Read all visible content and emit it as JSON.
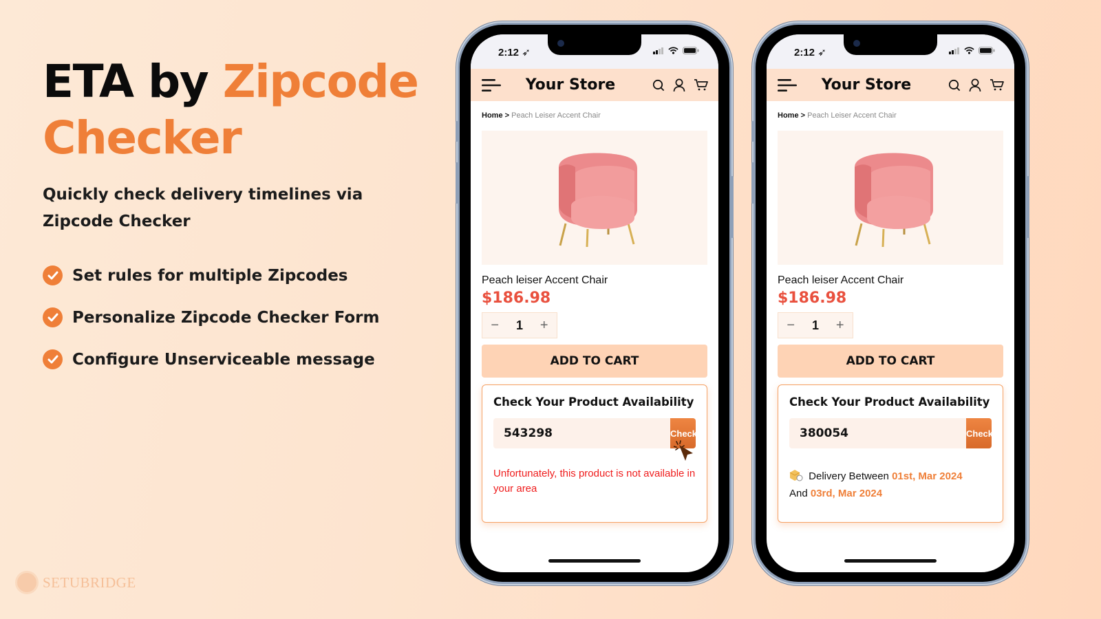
{
  "hero": {
    "title_part1": "ETA by ",
    "title_part2": "Zipcode",
    "title_part3": "Checker",
    "subtitle": "Quickly check delivery timelines via Zipcode Checker"
  },
  "features": [
    {
      "label": "Set rules for multiple Zipcodes",
      "icon": "check-circle-icon"
    },
    {
      "label": "Personalize Zipcode Checker Form",
      "icon": "check-circle-icon"
    },
    {
      "label": "Configure Unserviceable message",
      "icon": "check-circle-icon"
    }
  ],
  "brand": {
    "name": "SETUBRIDGE"
  },
  "colors": {
    "accent": "#ef7f38",
    "error": "#ef1c1c",
    "price": "#e9503e",
    "header_bg": "#fde0cc"
  },
  "phones": [
    {
      "status_time": "2:12",
      "store_title": "Your Store",
      "breadcrumb_home": "Home >",
      "breadcrumb_current": "Peach Leiser  Accent Chair",
      "product_name": "Peach leiser Accent Chair",
      "price": "$186.98",
      "qty_minus": "−",
      "qty_value": "1",
      "qty_plus": "+",
      "add_to_cart": "ADD TO CART",
      "availability_title": "Check Your Product Availability",
      "zip_value": "543298",
      "check_label": "Check",
      "error_message": "Unfortunately, this product is not available in your area"
    },
    {
      "status_time": "2:12",
      "store_title": "Your Store",
      "breadcrumb_home": "Home >",
      "breadcrumb_current": "Peach Leiser  Accent Chair",
      "product_name": "Peach leiser Accent Chair",
      "price": "$186.98",
      "qty_minus": "−",
      "qty_value": "1",
      "qty_plus": "+",
      "add_to_cart": "ADD TO CART",
      "availability_title": "Check Your Product Availability",
      "zip_value": "380054",
      "check_label": "Check",
      "delivery_prefix": "Delivery Between",
      "delivery_start": "01st, Mar 2024",
      "delivery_and": "And",
      "delivery_end": "03rd, Mar 2024"
    }
  ]
}
